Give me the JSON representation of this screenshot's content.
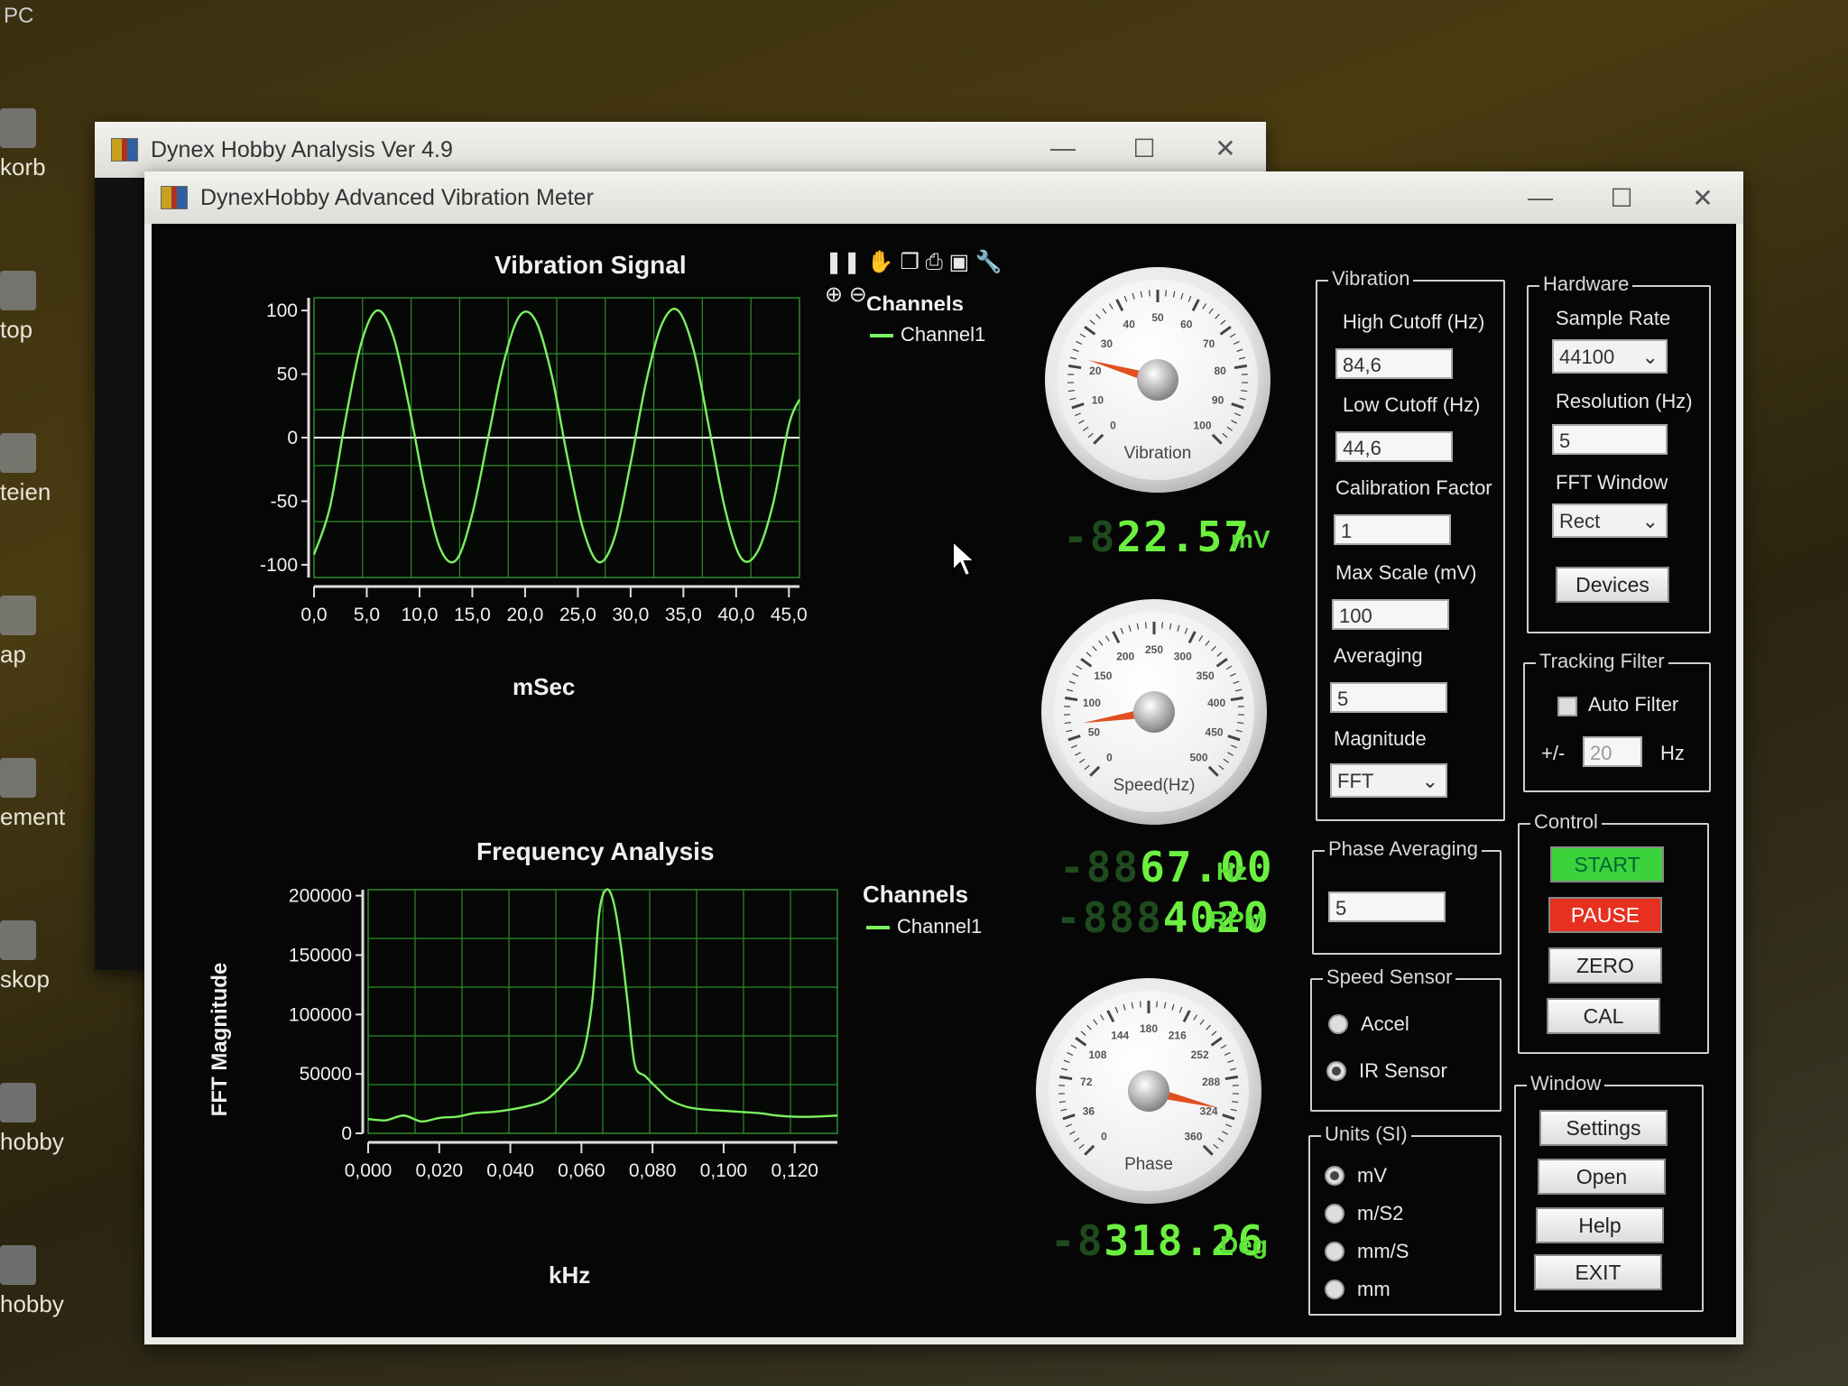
{
  "desktop": {
    "top_label": "PC",
    "icons": [
      "korb",
      "top",
      "teien",
      "ap",
      "ement",
      "skop",
      "hobby",
      "hobby"
    ]
  },
  "back_window": {
    "title": "Dynex Hobby Analysis Ver 4.9"
  },
  "main_window": {
    "title": "DynexHobby Advanced Vibration Meter"
  },
  "vibration_chart": {
    "title": "Vibration Signal",
    "legend_title": "Channels",
    "legend_item": "Channel1",
    "x_label": "mSec",
    "x_ticks": [
      "0,0",
      "5,0",
      "10,0",
      "15,0",
      "20,0",
      "25,0",
      "30,0",
      "35,0",
      "40,0",
      "45,0"
    ],
    "y_ticks": [
      "100",
      "50",
      "0",
      "-50",
      "-100"
    ]
  },
  "frequency_chart": {
    "title": "Frequency Analysis",
    "legend_title": "Channels",
    "legend_item": "Channel1",
    "x_label": "kHz",
    "y_label": "FFT Magnitude",
    "x_ticks": [
      "0,000",
      "0,020",
      "0,040",
      "0,060",
      "0,080",
      "0,100",
      "0,120"
    ],
    "y_ticks": [
      "200000",
      "150000",
      "100000",
      "50000",
      "0"
    ]
  },
  "chart_data": [
    {
      "type": "line",
      "title": "Vibration Signal",
      "xlabel": "mSec",
      "ylabel": "",
      "xlim": [
        0,
        46
      ],
      "ylim": [
        -110,
        110
      ],
      "series": [
        {
          "name": "Channel1",
          "x": [
            0,
            1.5,
            3,
            4.5,
            6,
            7.5,
            9,
            10.5,
            12,
            13.5,
            15,
            16.5,
            18,
            19.5,
            21,
            22.5,
            24,
            25.5,
            27,
            28.5,
            30,
            31.5,
            33,
            34.5,
            36,
            37.5,
            39,
            40.5,
            42,
            43.5,
            45,
            46
          ],
          "y": [
            -92,
            -55,
            15,
            75,
            100,
            80,
            25,
            -40,
            -88,
            -96,
            -60,
            0,
            60,
            96,
            92,
            50,
            -15,
            -72,
            -98,
            -78,
            -20,
            45,
            90,
            100,
            68,
            5,
            -58,
            -95,
            -90,
            -52,
            10,
            30
          ]
        }
      ],
      "grid": true
    },
    {
      "type": "line",
      "title": "Frequency Analysis",
      "xlabel": "kHz",
      "ylabel": "FFT Magnitude",
      "xlim": [
        0,
        0.132
      ],
      "ylim": [
        0,
        205000
      ],
      "series": [
        {
          "name": "Channel1",
          "x": [
            0,
            0.005,
            0.01,
            0.015,
            0.02,
            0.025,
            0.03,
            0.035,
            0.04,
            0.045,
            0.05,
            0.055,
            0.06,
            0.063,
            0.065,
            0.067,
            0.069,
            0.071,
            0.073,
            0.075,
            0.078,
            0.082,
            0.085,
            0.09,
            0.095,
            0.1,
            0.105,
            0.11,
            0.115,
            0.12,
            0.125,
            0.132
          ],
          "y": [
            12000,
            11000,
            15000,
            10000,
            13000,
            14000,
            17000,
            18000,
            20000,
            23000,
            28000,
            42000,
            62000,
            110000,
            185000,
            205000,
            195000,
            160000,
            110000,
            58000,
            48000,
            36000,
            28000,
            22000,
            20000,
            19000,
            18000,
            17000,
            15000,
            14000,
            14000,
            15000
          ]
        }
      ],
      "grid": true
    }
  ],
  "gauges": {
    "vibration": {
      "caption": "Vibration",
      "ticks": [
        "0",
        "10",
        "20",
        "30",
        "40",
        "50",
        "60",
        "70",
        "80",
        "90",
        "100"
      ],
      "needle_value": 22.57,
      "max": 100
    },
    "speed": {
      "caption": "Speed(Hz)",
      "ticks": [
        "0",
        "50",
        "100",
        "150",
        "200",
        "250",
        "300",
        "350",
        "400",
        "450",
        "500"
      ],
      "needle_value": 67,
      "max": 500
    },
    "phase": {
      "caption": "Phase",
      "ticks": [
        "0",
        "36",
        "72",
        "108",
        "144",
        "180",
        "216",
        "252",
        "288",
        "324",
        "360"
      ],
      "needle_value": 318.26,
      "max": 360
    }
  },
  "readouts": {
    "vibration": {
      "dim": "-8",
      "value": "22.57",
      "unit": "mV"
    },
    "speed_hz": {
      "dim": "-88",
      "value": "67.00",
      "unit": "Hz"
    },
    "speed_rpm": {
      "dim": "-888",
      "value": "4020",
      "unit": "RPM"
    },
    "phase": {
      "dim": "-8",
      "value": "318.26",
      "unit": "Deg"
    }
  },
  "vibration_group": {
    "title": "Vibration",
    "high_cutoff_label": "High Cutoff (Hz)",
    "high_cutoff_value": "84,6",
    "low_cutoff_label": "Low Cutoff (Hz)",
    "low_cutoff_value": "44,6",
    "calibration_label": "Calibration Factor",
    "calibration_value": "1",
    "max_scale_label": "Max Scale (mV)",
    "max_scale_value": "100",
    "averaging_label": "Averaging",
    "averaging_value": "5",
    "magnitude_label": "Magnitude",
    "magnitude_value": "FFT"
  },
  "phase_group": {
    "title": "Phase Averaging",
    "value": "5"
  },
  "speed_sensor": {
    "title": "Speed Sensor",
    "options": [
      "Accel",
      "IR Sensor"
    ],
    "selected": 1
  },
  "units": {
    "title": "Units (SI)",
    "options": [
      "mV",
      "m/S2",
      "mm/S",
      "mm"
    ],
    "selected": 0
  },
  "hardware": {
    "title": "Hardware",
    "sample_rate_label": "Sample Rate",
    "sample_rate_value": "44100",
    "resolution_label": "Resolution (Hz)",
    "resolution_value": "5",
    "fft_window_label": "FFT Window",
    "fft_window_value": "Rect",
    "devices_label": "Devices"
  },
  "tracking": {
    "title": "Tracking Filter",
    "auto_filter_label": "Auto Filter",
    "pm_label": "+/-",
    "value": "20",
    "unit": "Hz"
  },
  "control": {
    "title": "Control",
    "start": "START",
    "pause": "PAUSE",
    "zero": "ZERO",
    "cal": "CAL",
    "start_color": "#3cd23c",
    "pause_color": "#e83020"
  },
  "window_group": {
    "title": "Window",
    "settings": "Settings",
    "open": "Open",
    "help": "Help",
    "exit": "EXIT"
  },
  "colors": {
    "trace": "#7cf060",
    "grid": "#2f8a2f",
    "zero_line": "#ffffff"
  }
}
